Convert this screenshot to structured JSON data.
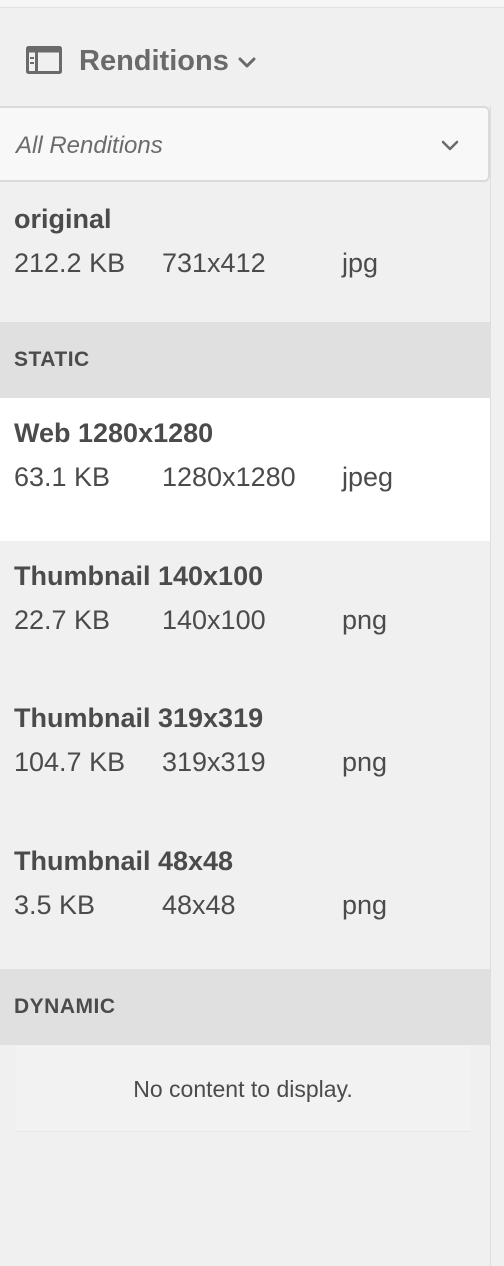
{
  "header": {
    "title": "Renditions",
    "icon": "rail-panel-icon",
    "dropdown_icon": "chevron-down-icon"
  },
  "filter": {
    "value": "All Renditions",
    "icon": "chevron-down-icon"
  },
  "original": {
    "name": "original",
    "size": "212.2 KB",
    "dimensions": "731x412",
    "format": "jpg"
  },
  "static_section": {
    "label": "STATIC",
    "items": [
      {
        "name": "Web 1280x1280",
        "size": "63.1 KB",
        "dimensions": "1280x1280",
        "format": "jpeg",
        "selected": true
      },
      {
        "name": "Thumbnail 140x100",
        "size": "22.7 KB",
        "dimensions": "140x100",
        "format": "png"
      },
      {
        "name": "Thumbnail 319x319",
        "size": "104.7 KB",
        "dimensions": "319x319",
        "format": "png"
      },
      {
        "name": "Thumbnail 48x48",
        "size": "3.5 KB",
        "dimensions": "48x48",
        "format": "png"
      }
    ]
  },
  "dynamic_section": {
    "label": "DYNAMIC",
    "empty_message": "No content to display."
  },
  "colors": {
    "selected_row": "#ffffff",
    "section_header": "#e0e0e0",
    "panel_bg": "#f0f0f0"
  }
}
